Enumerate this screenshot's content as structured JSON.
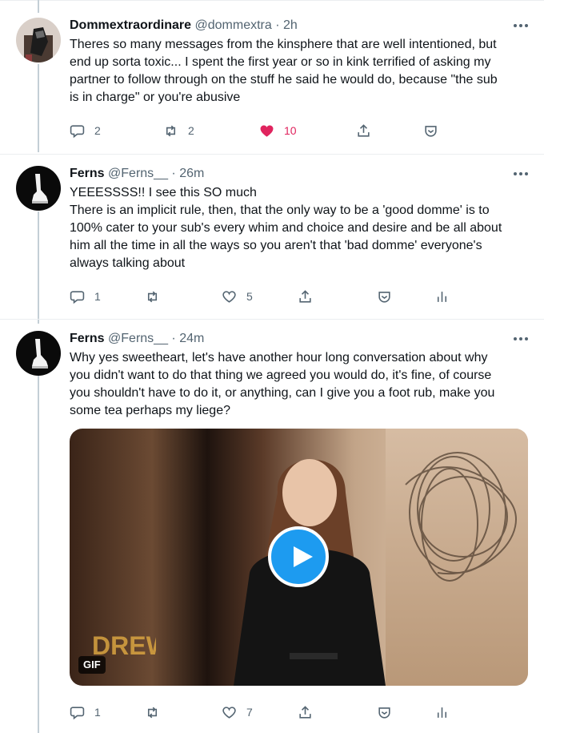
{
  "tweets": [
    {
      "name": "Dommextraordinare",
      "handle": "@dommextra",
      "time": "· 2h",
      "lines": [
        "Theres so many messages from the kinsphere that are well intentioned, but",
        "end up sorta toxic... I spent the first year or so in kink terrified of asking my",
        "partner to follow through on the stuff he said he would do, because \"the sub",
        "is in charge\" or you're abusive"
      ],
      "replies": "2",
      "retweets": "2",
      "likes": "10"
    },
    {
      "name": "Ferns",
      "handle": "@Ferns__",
      "time": "· 26m",
      "lines": [
        "YEEESSSS!! I see this SO much",
        "There is an implicit rule, then, that the only way to be a 'good domme' is to",
        "100% cater to your sub's every whim and choice and desire and be all about",
        "him all the time in all the ways so you aren't that 'bad domme' everyone's",
        "always talking about"
      ],
      "replies": "1",
      "retweets": "",
      "likes": "5"
    },
    {
      "name": "Ferns",
      "handle": "@Ferns__",
      "time": "· 24m",
      "lines": [
        "Why yes sweetheart, let's have another hour long conversation about why",
        "you didn't want to do that thing we agreed you would do, it's fine, of course",
        "you shouldn't have to do it, or anything, can I give you a foot rub, make you",
        "some tea perhaps my liege?"
      ],
      "media": {
        "badge": "GIF",
        "logo_text": "DREW"
      },
      "replies": "1",
      "retweets": "",
      "likes": "7"
    }
  ],
  "icons": {
    "reply": "speech-bubble-icon",
    "retweet": "retweet-arrows-icon",
    "like": "heart-icon",
    "share": "share-upload-icon",
    "tip": "shield-tip-icon",
    "analytics": "bar-chart-icon",
    "more": "three-dots-icon",
    "play": "play-icon"
  },
  "colors": {
    "like_active": "#e0245e",
    "play_button": "#1d9bf0",
    "muted_text": "#536471"
  }
}
